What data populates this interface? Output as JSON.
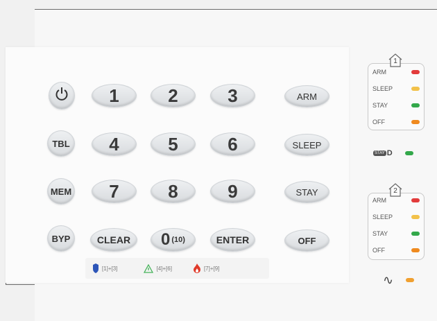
{
  "keys": {
    "power_icon": "power-icon",
    "tbl": "TBL",
    "mem": "MEM",
    "byp": "BYP",
    "digits": [
      "1",
      "2",
      "3",
      "4",
      "5",
      "6",
      "7",
      "8",
      "9"
    ],
    "clear": "CLEAR",
    "zero": "0",
    "zero_sub": "(10)",
    "enter": "ENTER",
    "arm": "ARM",
    "sleep": "SLEEP",
    "stay": "STAY",
    "off": "OFF"
  },
  "combos": {
    "police": "[1]+[3]",
    "medical": "[4]+[6]",
    "fire": "[7]+[9]"
  },
  "area1": {
    "number": "1",
    "rows": [
      "ARM",
      "SLEEP",
      "STAY",
      "OFF"
    ]
  },
  "area2": {
    "number": "2",
    "rows": [
      "ARM",
      "SLEEP",
      "STAY",
      "OFF"
    ]
  },
  "stayd": {
    "badge": "STAY",
    "suffix": "D"
  },
  "power_symbol": "∿",
  "colors": {
    "arm": "#e23b3b",
    "sleep": "#f2c14a",
    "stay": "#33a84a",
    "off": "#ef8a1f",
    "power": "#f0a030"
  }
}
